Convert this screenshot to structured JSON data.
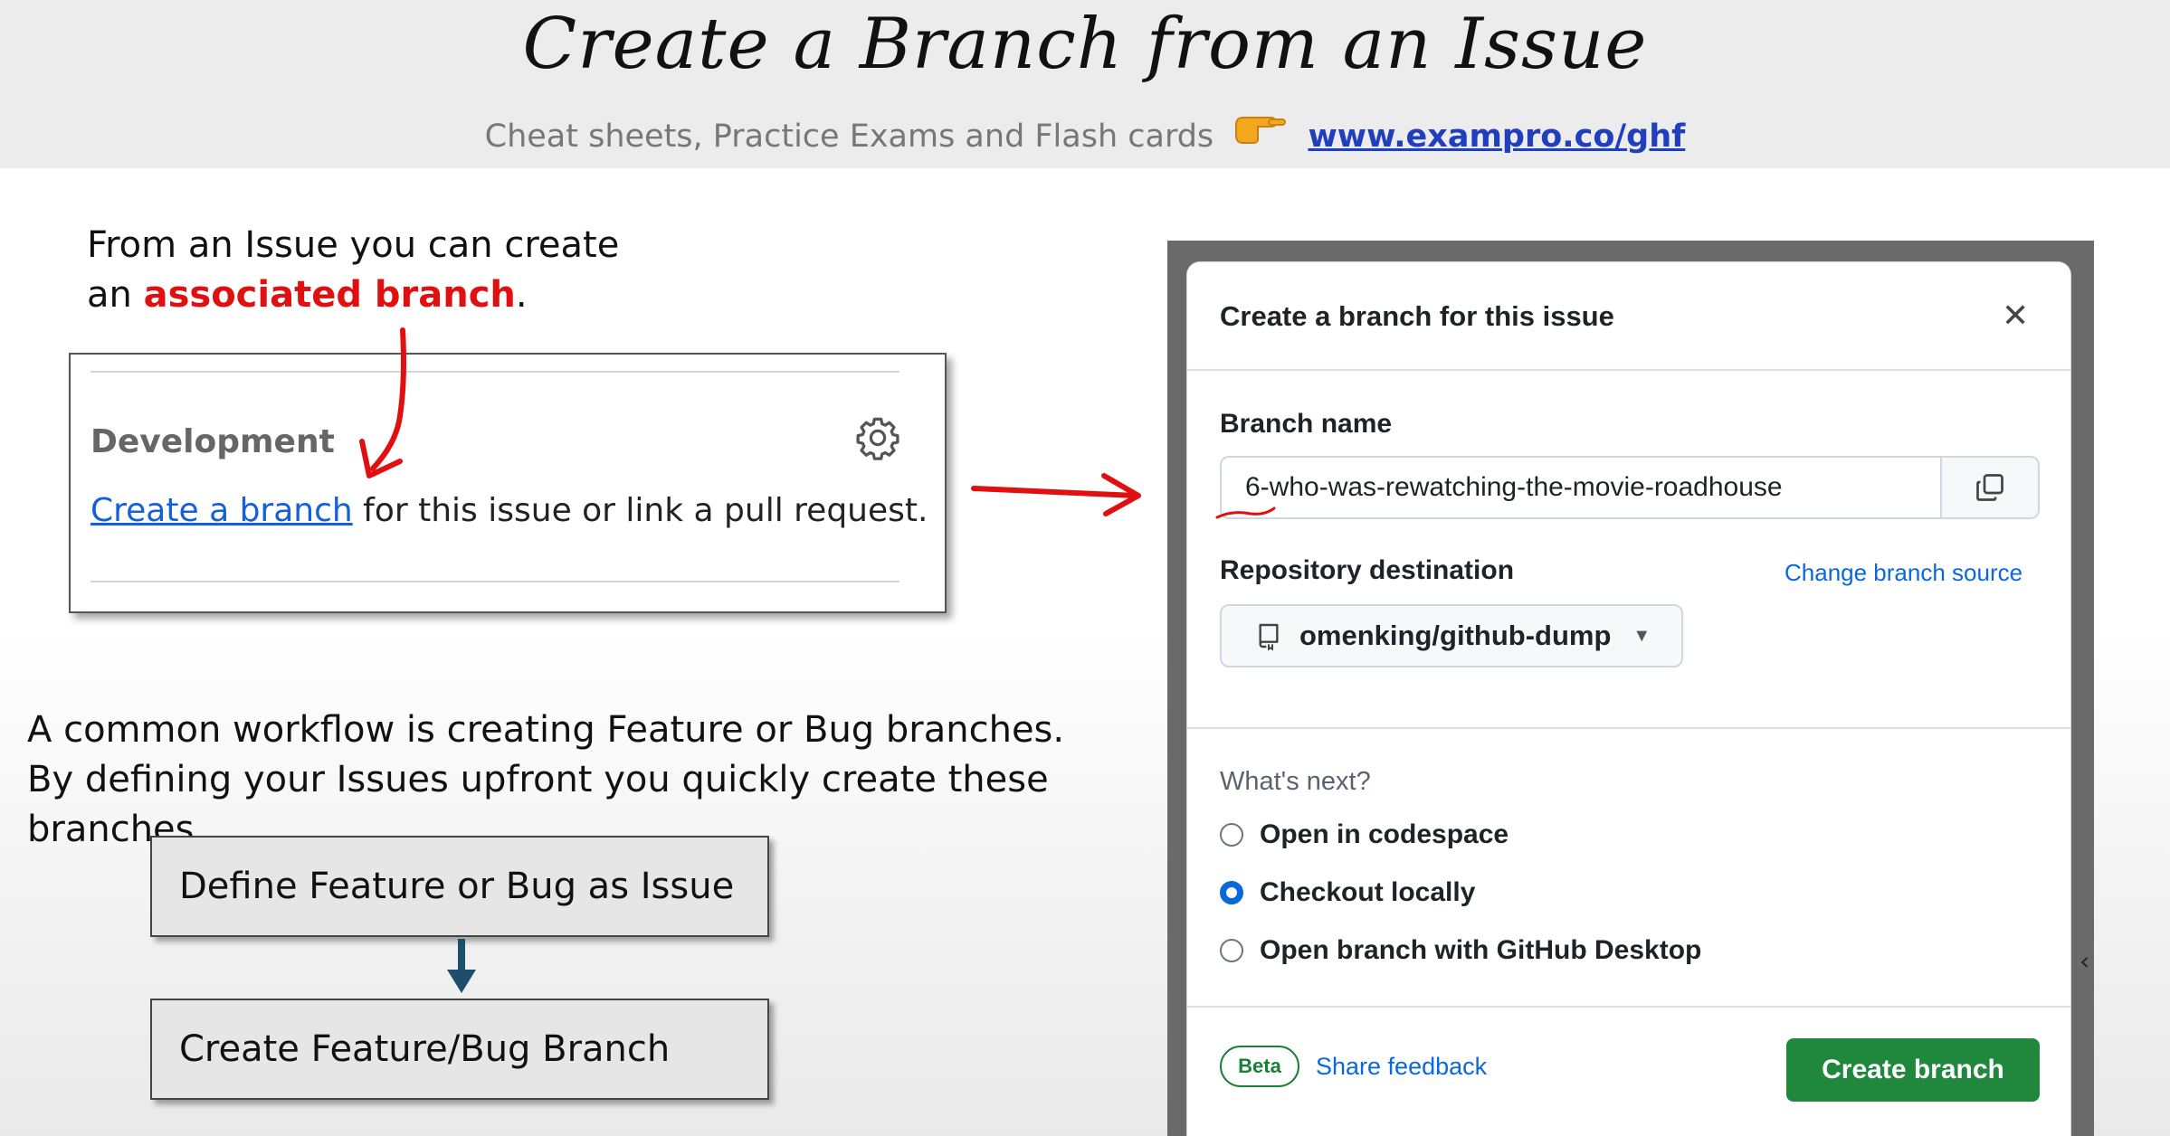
{
  "slide": {
    "title": "Create a Branch from an Issue",
    "subtitle": "Cheat sheets, Practice Exams and Flash cards",
    "link_text": "www.exampro.co/ghf",
    "intro_line1": "From an Issue you can create",
    "intro_prefix": "an ",
    "intro_highlight": "associated branch",
    "intro_suffix": ".",
    "workflow_line1": "A common workflow is creating Feature or Bug branches.",
    "workflow_line2": "By defining your Issues upfront you quickly create these branches",
    "flow_step1": "Define Feature or Bug as Issue",
    "flow_step2": "Create Feature/Bug Branch"
  },
  "development_panel": {
    "title": "Development",
    "link_text": "Create a branch",
    "rest_text": " for this issue or link a pull request."
  },
  "dialog": {
    "title": "Create a branch for this issue",
    "branch_name_label": "Branch name",
    "branch_name_value": "6-who-was-rewatching-the-movie-roadhouse",
    "repo_label": "Repository destination",
    "change_source": "Change branch source",
    "repo_value": "omenking/github-dump",
    "whats_next": "What's next?",
    "options": [
      {
        "label": "Open in codespace",
        "selected": false
      },
      {
        "label": "Checkout locally",
        "selected": true
      },
      {
        "label": "Open branch with GitHub Desktop",
        "selected": false
      }
    ],
    "beta_badge": "Beta",
    "share_feedback": "Share feedback",
    "create_button": "Create branch"
  },
  "icons": [
    "pointing-hand-icon",
    "gear-icon",
    "close-icon",
    "copy-icon",
    "repo-icon",
    "caret-down-icon"
  ],
  "colors": {
    "accent_red": "#e01010",
    "link_blue": "#1560d6",
    "github_green": "#1f883d",
    "github_blue": "#0969da"
  }
}
